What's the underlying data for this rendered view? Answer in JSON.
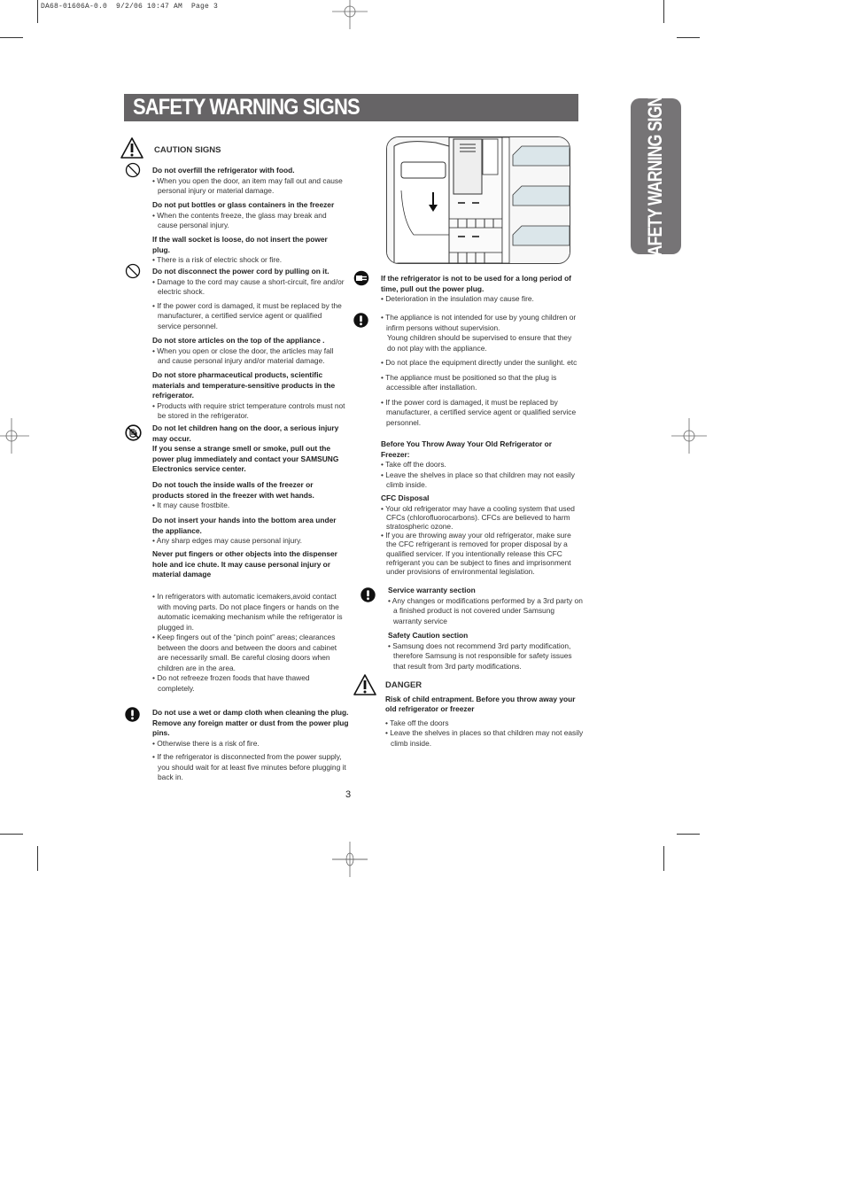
{
  "print_slug": "DA68-01606A-0.0  9/2/06 10:47 AM  Page 3",
  "header": {
    "title": "SAFETY WARNING SIGNS"
  },
  "side_tab": {
    "label": "SAFETY WARNING SIGNS"
  },
  "colors": {
    "title_bar": "#666466",
    "side_tab": "#767476"
  },
  "left": {
    "caution_heading": "CAUTION SIGNS",
    "blocks": [
      {
        "heading": "Do not overfill the refrigerator with food.",
        "bullets": [
          "• When you open the door, an item may fall out and cause personal injury or material damage."
        ]
      },
      {
        "heading": "Do not put bottles or glass containers in the freezer",
        "bullets": [
          "• When the contents freeze, the glass may break and cause personal injury."
        ]
      },
      {
        "heading": "If the wall socket is loose, do not insert the power plug.",
        "bullets": [
          "• There is a risk of electric shock or fire."
        ]
      },
      {
        "heading": "Do not disconnect the power cord by pulling on it.",
        "bullets": [
          "• Damage to the cord may cause a short-circuit, fire and/or electric shock.",
          "• If the power cord is damaged, it must be replaced by the manufacturer, a certified service agent or qualified service personnel."
        ]
      },
      {
        "heading": "Do not store articles on the top of the appliance .",
        "bullets": [
          "• When you open or close the door, the articles may fall and cause personal injury and/or material damage."
        ]
      },
      {
        "heading": "Do not store pharmaceutical products, scientific materials and temperature-sensitive products in the refrigerator.",
        "bullets": [
          "• Products with require strict temperature controls must not be stored in the refrigerator."
        ]
      },
      {
        "heading": "Do not let children hang on the door, a serious injury may occur.",
        "bullets": []
      },
      {
        "heading": "If you sense a strange smell or smoke, pull out the power plug immediately and contact your SAMSUNG Electronics service center.",
        "bullets": []
      },
      {
        "heading": "Do not touch the inside walls of the freezer or products stored in the freezer with wet hands.",
        "bullets": [
          "• It may cause frostbite."
        ]
      },
      {
        "heading": "Do not insert your hands into the bottom area under the appliance.",
        "bullets": [
          "• Any sharp edges may cause personal injury."
        ]
      },
      {
        "heading": "Never put fingers or other objects into the dispenser hole and ice chute.  It may cause personal injury or material damage",
        "bullets": []
      }
    ],
    "extra_bullets": [
      "• In refrigerators with automatic icemakers,avoid contact with moving parts. Do not place fingers or hands on the automatic icemaking mechanism while the refrigerator is plugged in.",
      "• Keep fingers out of the “pinch point” areas; clearances between the doors and between the doors and cabinet are necessarily small. Be careful closing doors when children are in the area.",
      "• Do not refreeze frozen foods that have thawed completely."
    ],
    "plug_block": {
      "heading": "Do not use a wet or damp cloth when cleaning the plug. Remove any foreign matter or dust from the power plug pins.",
      "bullets": [
        "• Otherwise there is a risk of fire.",
        "• If the refrigerator  is disconnected from the power supply, you should wait for at least five minutes before plugging it back in."
      ]
    }
  },
  "right": {
    "unplug_block": {
      "heading": "If the refrigerator  is not to be used for a long period of time, pull out the power plug.",
      "bullets": [
        "• Deterioration in the insulation may cause fire."
      ]
    },
    "notice_bullets": [
      "• The appliance is not intended for use by young children or infirm persons without supervision.",
      "Young children should be supervised to ensure that they do not play with the appliance.",
      "• Do not place the equipment directly under the sunlight. etc",
      "• The appliance must be positioned so that the plug is accessible after installation.",
      "• If the power cord is damaged, it must be replaced by manufacturer, a certified service agent or qualified service personnel."
    ],
    "disposal": {
      "heading": "Before You Throw Away Your Old Refrigerator or Freezer:",
      "bullets": [
        "• Take off the doors.",
        "• Leave the shelves in place so that children may not easily climb inside."
      ]
    },
    "cfc": {
      "heading": "CFC Disposal",
      "bullets": [
        "• Your old refrigerator may have a cooling system that used CFCs (chlorofluorocarbons). CFCs are believed to harm stratospheric ozone.",
        "• If you are throwing away your old refrigerator, make sure the CFC refrigerant is removed for proper disposal by a qualified servicer. If you intentionally release this CFC refrigerant you can be subject to fines and imprisonment under provisions of environmental legislation."
      ]
    },
    "warranty": {
      "heading": "Service warranty section",
      "bullets": [
        "• Any changes or modifications performed by a 3rd party on a finished product is not covered under Samsung warranty service"
      ]
    },
    "safety_caution": {
      "heading": "Safety Caution section",
      "bullets": [
        "• Samsung does not recommend 3rd party modification, therefore Samsung is not responsible for safety issues that result from 3rd party modifications."
      ]
    },
    "danger": {
      "heading": "DANGER",
      "subheading": "Risk of child entrapment. Before you throw away your old refrigerator or freezer",
      "bullets": [
        "• Take off the doors",
        "• Leave the shelves in places so that children may not easily climb inside."
      ]
    }
  },
  "icons": [
    "warning-triangle-icon",
    "prohibition-icon",
    "no-hand-icon",
    "unplug-icon",
    "exclamation-icon"
  ],
  "page_number": "3"
}
